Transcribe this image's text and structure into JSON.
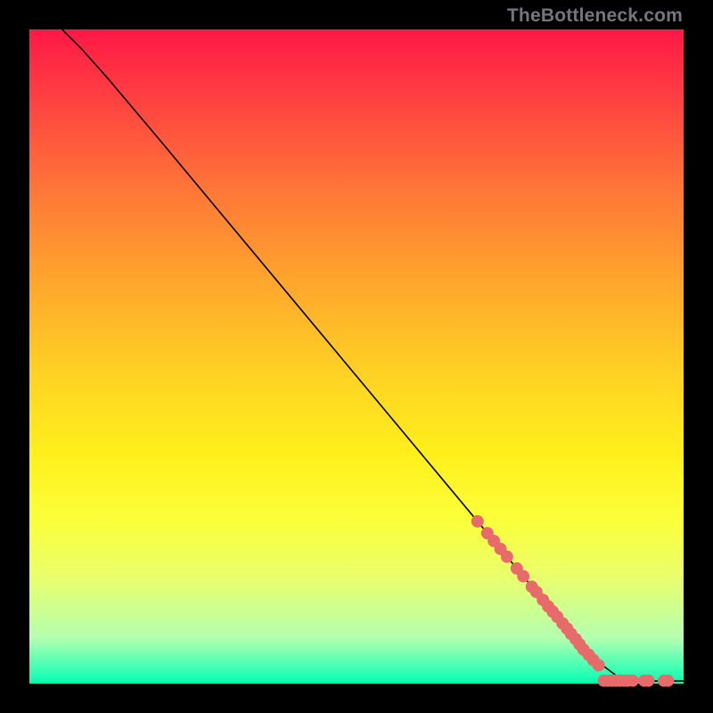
{
  "attribution": "TheBottleneck.com",
  "chart_data": {
    "type": "line",
    "title": "",
    "xlabel": "",
    "ylabel": "",
    "xlim": [
      0,
      100
    ],
    "ylim": [
      0,
      100
    ],
    "curve": {
      "name": "main-curve",
      "x": [
        5,
        8,
        12,
        20,
        30,
        40,
        50,
        60,
        70,
        80,
        86,
        90,
        95,
        100
      ],
      "y": [
        100,
        97,
        92.5,
        83,
        71,
        59,
        47,
        35,
        23,
        11,
        4,
        1,
        0.4,
        0.4
      ]
    },
    "scatter_on_curve": {
      "name": "curve-markers",
      "color": "#e86b6b",
      "x": [
        68.5,
        70,
        71,
        72,
        73,
        74.5,
        75.5,
        76.8,
        77.5,
        78.5,
        79.3,
        80,
        80.7,
        81.5,
        82.2,
        82.8,
        83.5,
        84.1,
        84.7,
        85.5,
        86.2,
        87
      ],
      "y": [
        24.8,
        23.0,
        21.8,
        20.6,
        19.4,
        17.6,
        16.4,
        14.8,
        14.0,
        12.8,
        11.8,
        11.0,
        10.2,
        9.2,
        8.4,
        7.6,
        6.8,
        6.0,
        5.2,
        4.4,
        3.6,
        2.8
      ]
    },
    "scatter_bottom": {
      "name": "bottom-markers",
      "color": "#e86b6b",
      "x": [
        87.8,
        88.4,
        89,
        89.6,
        90.2,
        90.8,
        91.4,
        92.2,
        94,
        94.6,
        97,
        97.6
      ],
      "y": [
        0.45,
        0.45,
        0.45,
        0.45,
        0.45,
        0.45,
        0.45,
        0.45,
        0.45,
        0.45,
        0.45,
        0.45
      ]
    }
  }
}
